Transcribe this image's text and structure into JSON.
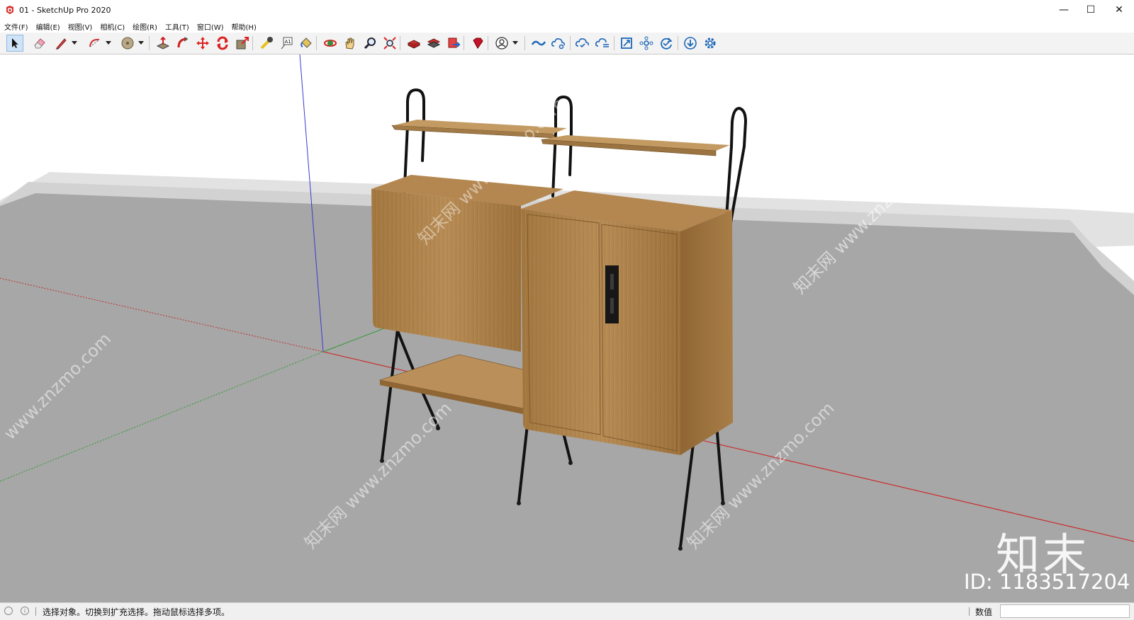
{
  "window": {
    "title": "01 - SketchUp Pro 2020",
    "minimize": "—",
    "maximize": "☐",
    "close": "✕"
  },
  "menu": [
    {
      "label": "文件(F)"
    },
    {
      "label": "编辑(E)"
    },
    {
      "label": "视图(V)"
    },
    {
      "label": "相机(C)"
    },
    {
      "label": "绘图(R)"
    },
    {
      "label": "工具(T)"
    },
    {
      "label": "窗口(W)"
    },
    {
      "label": "帮助(H)"
    }
  ],
  "toolbar": {
    "tools": [
      {
        "name": "select-icon",
        "selected": true
      },
      {
        "name": "eraser-icon"
      },
      {
        "name": "pencil-line-icon"
      },
      {
        "name": "arc-icon"
      },
      {
        "name": "shape-circle-icon"
      },
      {
        "name": "push-pull-icon"
      },
      {
        "name": "follow-me-icon"
      },
      {
        "name": "move-icon"
      },
      {
        "name": "rotate-icon"
      },
      {
        "name": "scale-icon"
      },
      {
        "name": "tape-measure-icon"
      },
      {
        "name": "text-icon"
      },
      {
        "name": "paint-bucket-icon"
      },
      {
        "name": "orbit-icon"
      },
      {
        "name": "pan-icon"
      },
      {
        "name": "zoom-icon"
      },
      {
        "name": "zoom-extents-icon"
      },
      {
        "name": "warehouse-icon"
      },
      {
        "name": "extension-warehouse-icon"
      },
      {
        "name": "send-to-layout-icon"
      },
      {
        "name": "ruby-console-icon"
      },
      {
        "name": "user-account-icon"
      },
      {
        "name": "trimble-connect-icon"
      },
      {
        "name": "cloud-share-icon"
      },
      {
        "name": "cloud-sync-icon"
      },
      {
        "name": "cloud-list-icon"
      },
      {
        "name": "component-box-icon"
      },
      {
        "name": "network-icon"
      },
      {
        "name": "refresh-check-icon"
      },
      {
        "name": "download-icon"
      },
      {
        "name": "settings-gear-icon"
      }
    ],
    "text_tool_label": "A1"
  },
  "viewport": {
    "watermark_site": "www.znzmo.com",
    "watermark_cn": "知末网",
    "brand_logo": "知末",
    "id_label": "ID: 1183517204"
  },
  "status": {
    "hint": "选择对象。切换到扩充选择。拖动鼠标选择多项。",
    "info_icon": "i",
    "measurements_label": "数值",
    "measurements_value": ""
  }
}
